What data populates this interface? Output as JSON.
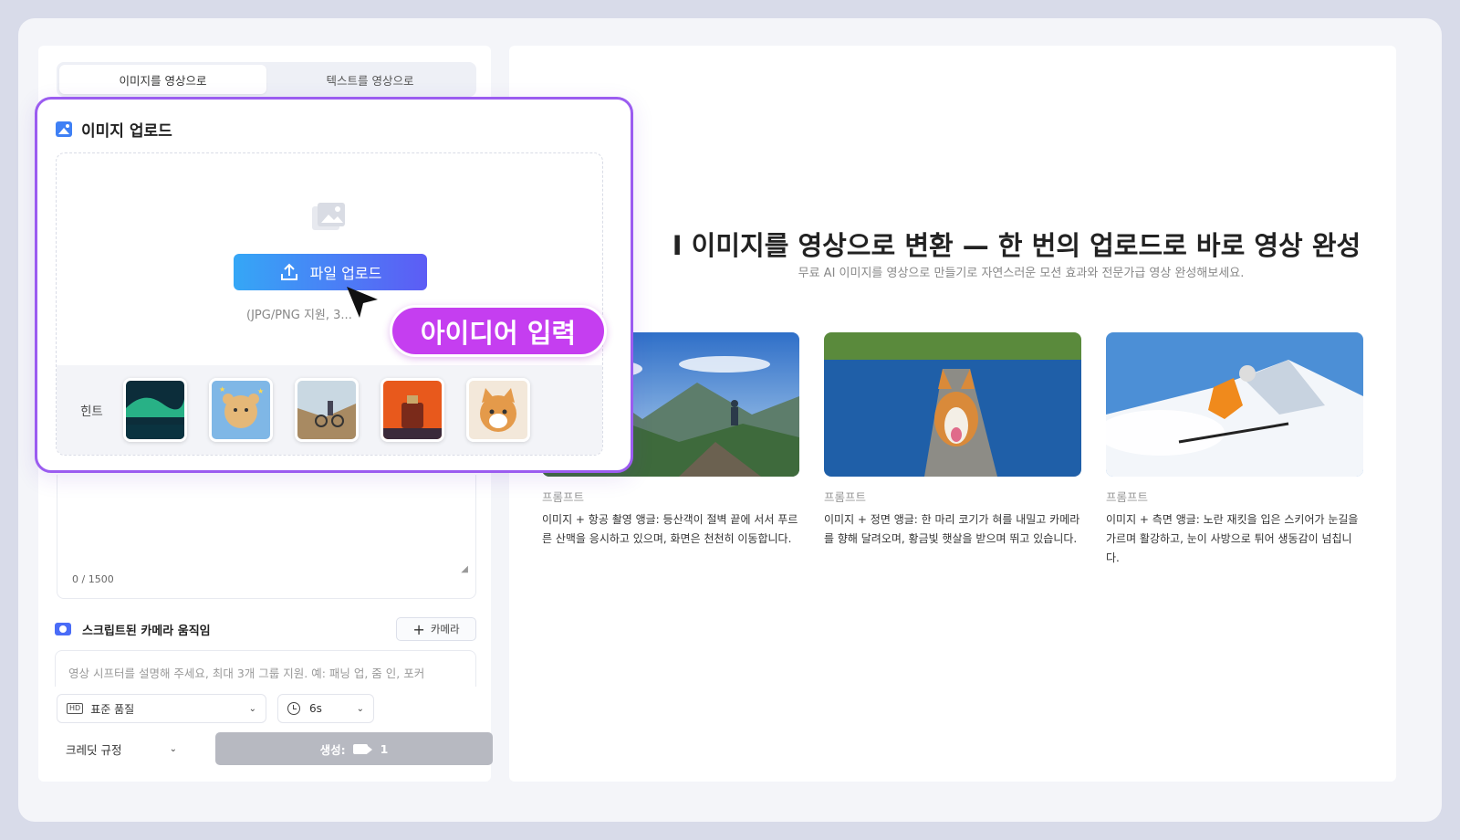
{
  "tabs": [
    {
      "label": "이미지를 영상으로",
      "active": true
    },
    {
      "label": "텍스트를 영상으로",
      "active": false
    }
  ],
  "upload": {
    "title": "이미지 업로드",
    "button_label": "파일 업로드",
    "support_text": "(JPG/PNG 지원, 3...",
    "hint_label": "힌트",
    "hint_thumbnails": [
      "aurora",
      "teddy-bear",
      "mountain-biker",
      "perfume-bottle",
      "orange-cat"
    ]
  },
  "badge": {
    "label": "아이디어 입력"
  },
  "prompt": {
    "char_count": "0 / 1500"
  },
  "camera": {
    "label": "스크립트된 카메라 움직임",
    "add_button": "카메라",
    "placeholder": "영상 시프터를 설명해 주세요, 최대 3개 그룹 지원. 예: 패닝 업, 줌 인, 포커"
  },
  "settings": {
    "quality": "표준 품질",
    "duration": "6s",
    "credit_rule": "크레딧 규정",
    "generate_label": "생성:",
    "generate_cost": "1"
  },
  "hero": {
    "title": "I 이미지를 영상으로 변환 — 한 번의 업로드로 바로 영상 완성",
    "subtitle": "무료 AI 이미지를 영상으로 만들기로 자연스러운 모션 효과와 전문가급 영상 완성해보세요."
  },
  "examples": [
    {
      "label": "프롬프트",
      "image": "mountain-hiker",
      "text": "이미지 + 항공 촬영 앵글: 등산객이 절벽 끝에 서서 푸르른 산맥을 응시하고 있으며, 화면은 천천히 이동합니다."
    },
    {
      "label": "프롬프트",
      "image": "corgi-running",
      "text": "이미지 + 정면 앵글: 한 마리 코기가 혀를 내밀고 카메라를 향해 달려오며, 황금빛 햇살을 받으며 뛰고 있습니다."
    },
    {
      "label": "프롬프트",
      "image": "skier",
      "text": "이미지 + 측면 앵글: 노란 재킷을 입은 스키어가 눈길을 가르며 활강하고, 눈이 사방으로 튀어 생동감이 넘칩니다."
    }
  ],
  "colors": {
    "accent": "#9b5cf0",
    "badge": "#c53ef0",
    "button_start": "#35a7f6",
    "button_end": "#5d5cf5"
  }
}
